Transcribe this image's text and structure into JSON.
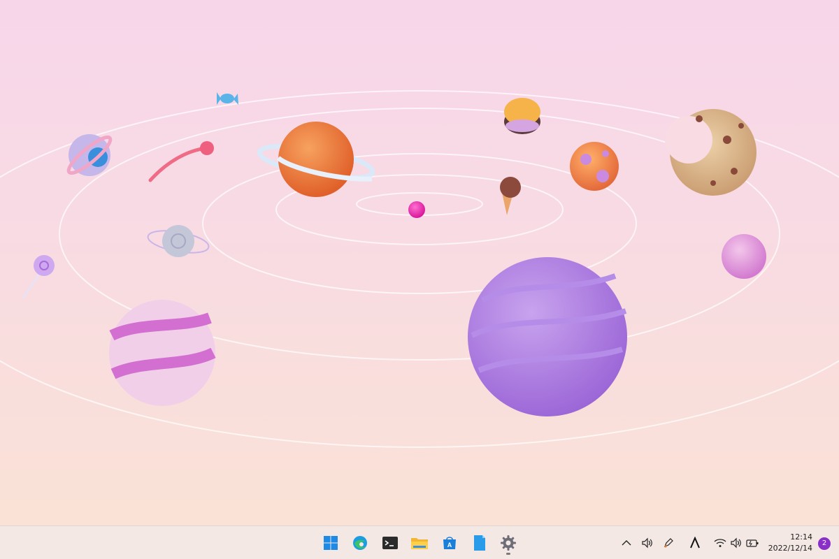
{
  "taskbar": {
    "apps": [
      {
        "name": "start",
        "icon": "windows-logo-icon"
      },
      {
        "name": "edge",
        "icon": "edge-browser-icon"
      },
      {
        "name": "terminal",
        "icon": "terminal-icon"
      },
      {
        "name": "file-explorer",
        "icon": "folder-icon"
      },
      {
        "name": "microsoft-store",
        "icon": "store-icon"
      },
      {
        "name": "notepad",
        "icon": "notepad-icon"
      },
      {
        "name": "settings",
        "icon": "gear-icon",
        "running": true
      }
    ],
    "tray": {
      "icons": [
        "chevron-up-icon",
        "volume-icon",
        "pen-icon",
        "font-icon",
        "wifi-icon",
        "speaker-icon",
        "battery-icon"
      ],
      "time": "12:14",
      "date": "2022/12/14",
      "notification_count": "2"
    }
  },
  "colors": {
    "accent": "#8b2fc9",
    "taskbar_bg": "#f3e8e4",
    "wallpaper_top": "#f7d6ea",
    "wallpaper_bottom": "#fae2d6"
  }
}
